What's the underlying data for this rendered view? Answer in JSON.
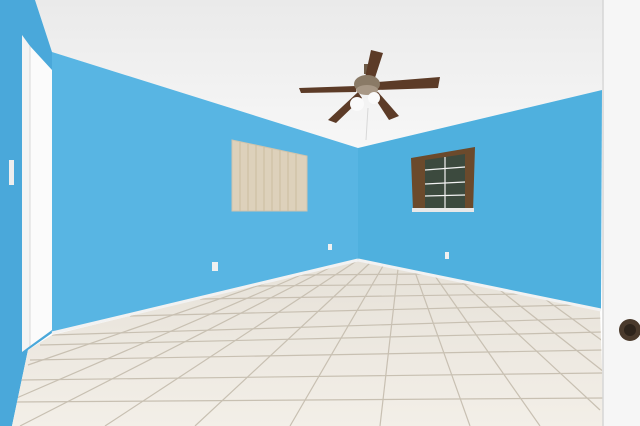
{
  "scene": {
    "kind": "photo",
    "subject": "empty-bedroom",
    "elements": [
      "ceiling",
      "ceiling-fan",
      "left-wall",
      "back-wall",
      "right-wall",
      "tiled-floor",
      "window-with-blinds",
      "window",
      "doorway",
      "open-door"
    ]
  },
  "colors": {
    "wall": "#5bb6e3",
    "wall_shade": "#4aa3d2",
    "ceiling": "#efefef",
    "floor": "#ece6dc",
    "grout": "#c9c2b6",
    "trim": "#f4f4f4",
    "fan_blade": "#5a3a26",
    "blind": "#e6dcc8",
    "window_frame": "#6b4a2c"
  }
}
